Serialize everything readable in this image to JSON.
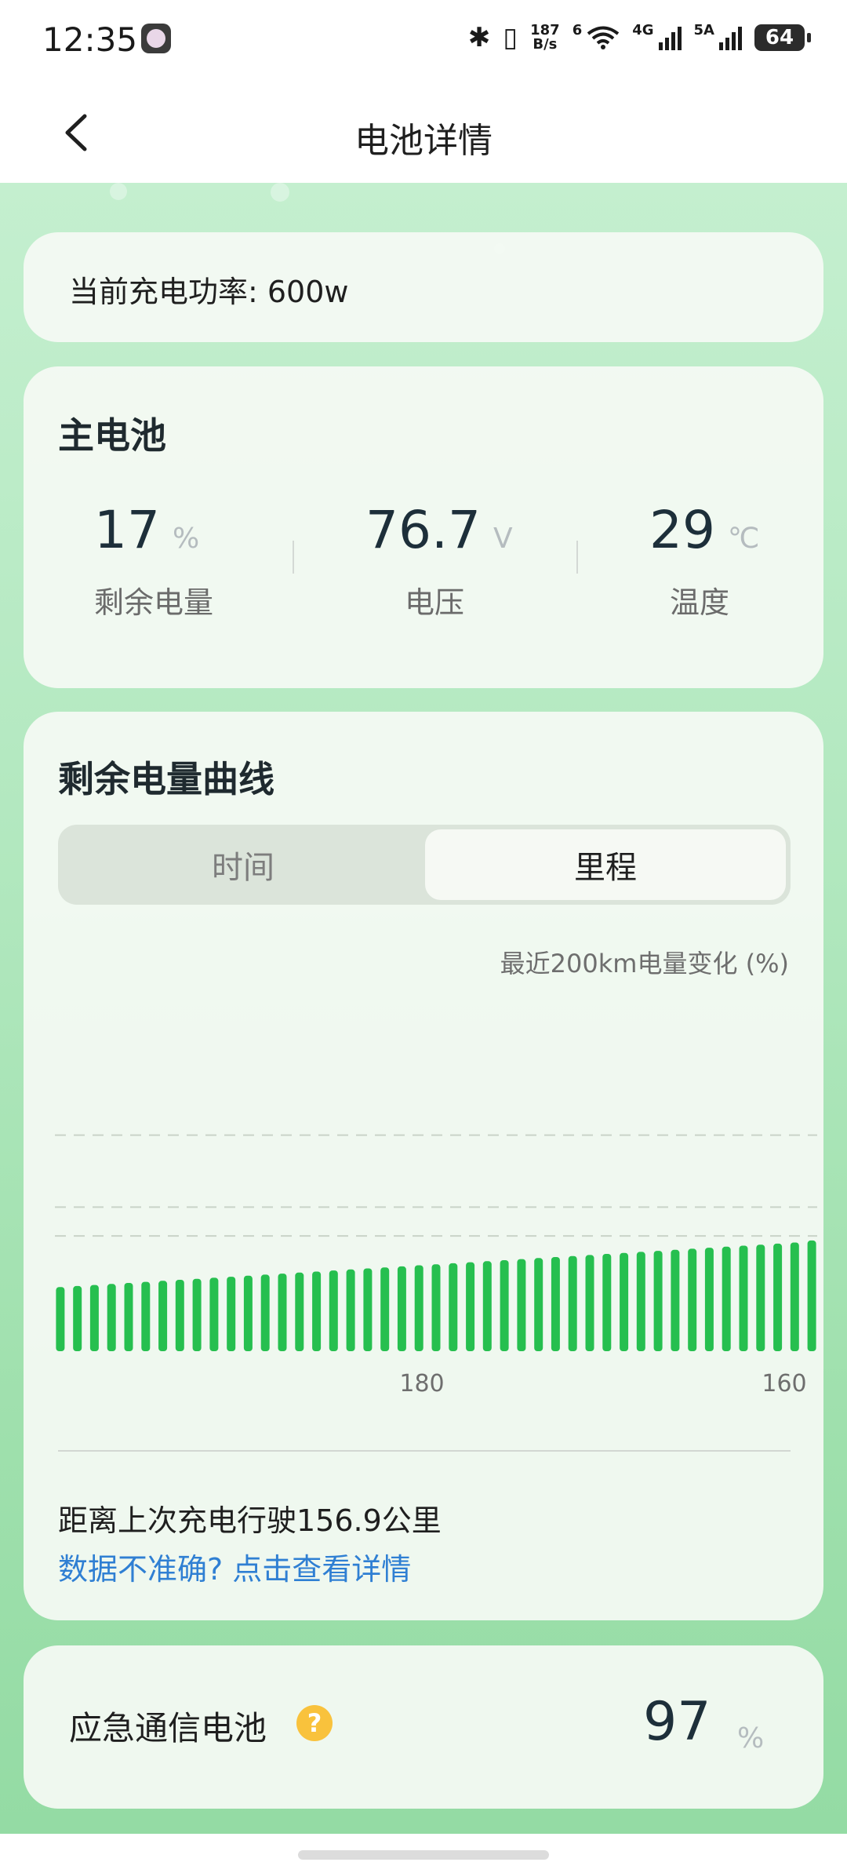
{
  "status_bar": {
    "time": "12:35",
    "bluetooth_icon": "bluetooth-icon",
    "vibrate_icon": "vibrate-icon",
    "net_speed_top": "187",
    "net_speed_bottom": "B/s",
    "wifi_label": "6",
    "sim1_label": "4G",
    "sim2_label": "5A",
    "battery_level": "64"
  },
  "header": {
    "title": "电池详情"
  },
  "power": {
    "text": "当前充电功率: 600w"
  },
  "main_battery": {
    "title": "主电池",
    "remaining": {
      "value": "17",
      "unit": "%",
      "label": "剩余电量"
    },
    "voltage": {
      "value": "76.7",
      "unit": "V",
      "label": "电压"
    },
    "temperature": {
      "value": "29",
      "unit": "℃",
      "label": "温度"
    }
  },
  "curve": {
    "title": "剩余电量曲线",
    "tabs": {
      "time": "时间",
      "mileage": "里程"
    },
    "active_tab": "mileage",
    "caption": "最近200km电量变化 (%)",
    "distance_text": "距离上次充电行驶156.9公里",
    "detail_link": "数据不准确? 点击查看详情"
  },
  "chart_data": {
    "type": "bar",
    "x_ticks": [
      "180",
      "160"
    ],
    "values": [
      31,
      31.5,
      32,
      32.5,
      33,
      33.5,
      34,
      34.5,
      35,
      35.5,
      36,
      36.5,
      37,
      37.5,
      38,
      38.5,
      39,
      39.5,
      40,
      40.5,
      41,
      41.5,
      42,
      42.5,
      43,
      43.5,
      44,
      44.5,
      45,
      45.5,
      46,
      46.5,
      47,
      47.5,
      48,
      48.5,
      49,
      49.5,
      50,
      50.5,
      51,
      51.5,
      52,
      52.5,
      53.5
    ],
    "gridlines": [
      40,
      50,
      75
    ],
    "grid": true,
    "color": "#26bf4f"
  },
  "emergency": {
    "label": "应急通信电池",
    "help_icon": "?",
    "value": "97",
    "unit": "%"
  }
}
